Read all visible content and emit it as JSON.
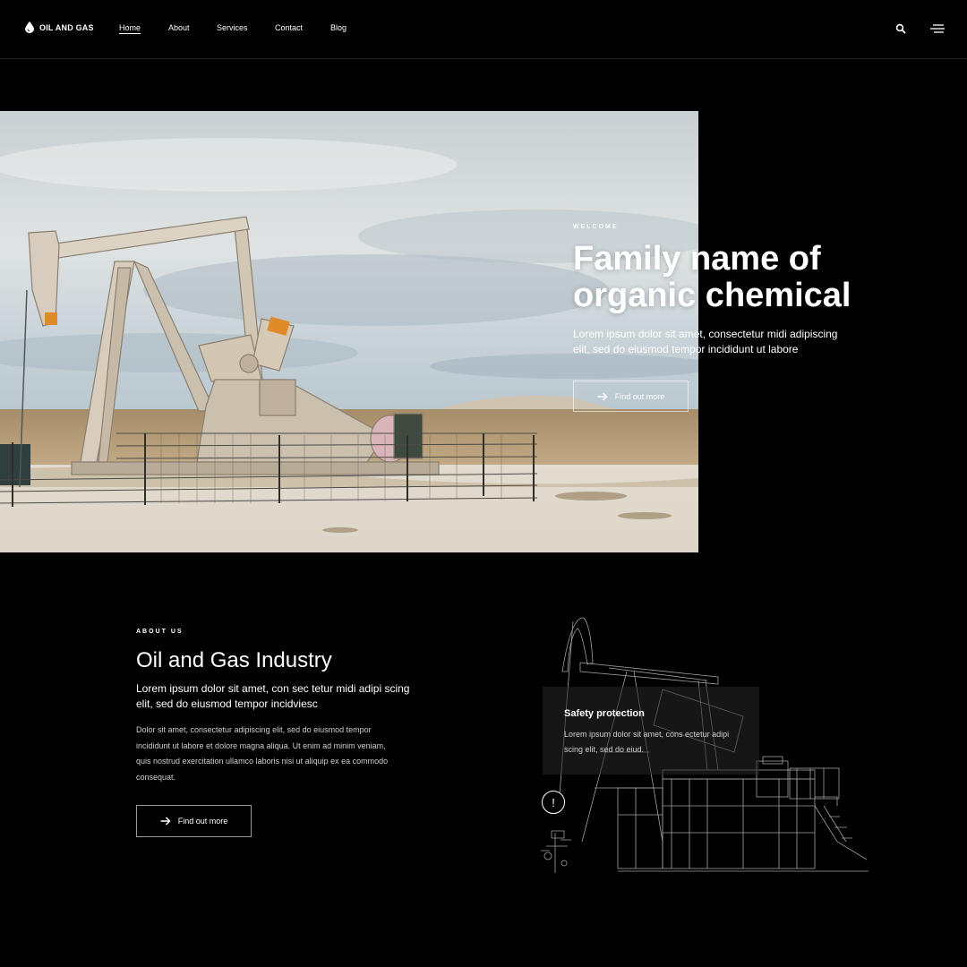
{
  "header": {
    "brand": "OIL AND GAS",
    "nav": [
      {
        "label": "Home",
        "active": true
      },
      {
        "label": "About",
        "active": false
      },
      {
        "label": "Services",
        "active": false
      },
      {
        "label": "Contact",
        "active": false
      },
      {
        "label": "Blog",
        "active": false
      }
    ],
    "icons": [
      "drop-icon",
      "search-icon",
      "hamburger-menu-icon"
    ]
  },
  "hero": {
    "eyebrow": "WELCOME",
    "title_line1": "Family name of",
    "title_line2": "organic chemical",
    "body": "Lorem ipsum dolor sit amet, consectetur midi adipiscing elit, sed do eiusmod tempor incididunt ut labore",
    "button_label": "Find out more",
    "image": "oil pumpjack in a fenced field on a dry prairie under a cloudy sky"
  },
  "about": {
    "eyebrow": "ABOUT US",
    "title": "Oil and Gas Industry",
    "lead": "Lorem ipsum dolor sit amet, con sec tetur midi adipi scing elit, sed do eiusmod tempor incidviesc",
    "body": "Dolor sit amet, consectetur adipiscing elit, sed do eiusmod tempor incididunt ut labore et dolore magna aliqua. Ut enim ad minim veniam, quis nostrud exercitation ullamco laboris nisi ut aliquip ex ea commodo consequat.",
    "button_label": "Find out more"
  },
  "safety": {
    "title": "Safety protection",
    "text": "Lorem ipsum dolor sit amet, cons ectetur adipi scing elit, sed do eiud.",
    "marker": "!"
  },
  "colors": {
    "background": "#000000",
    "text": "#ffffff",
    "muted": "#cfcfcf"
  }
}
